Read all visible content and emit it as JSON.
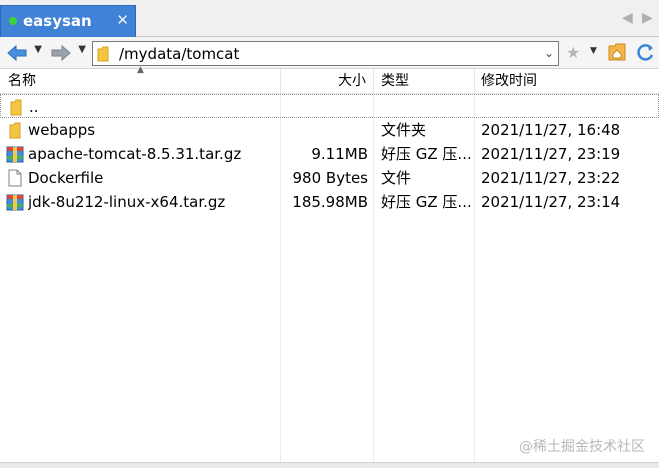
{
  "tab": {
    "label": "easysan",
    "close": "✕"
  },
  "address": {
    "path": "/mydata/tomcat"
  },
  "columns": {
    "name": "名称",
    "size": "大小",
    "type": "类型",
    "modified": "修改时间"
  },
  "files": [
    {
      "name": "..",
      "size": "",
      "type": "",
      "modified": "",
      "icon": "folder-icon"
    },
    {
      "name": "webapps",
      "size": "",
      "type": "文件夹",
      "modified": "2021/11/27, 16:48",
      "icon": "folder-icon"
    },
    {
      "name": "apache-tomcat-8.5.31.tar.gz",
      "size": "9.11MB",
      "type": "好压 GZ 压...",
      "modified": "2021/11/27, 23:19",
      "icon": "archive-icon"
    },
    {
      "name": "Dockerfile",
      "size": "980 Bytes",
      "type": "文件",
      "modified": "2021/11/27, 23:22",
      "icon": "file-icon"
    },
    {
      "name": "jdk-8u212-linux-x64.tar.gz",
      "size": "185.98MB",
      "type": "好压 GZ 压...",
      "modified": "2021/11/27, 23:14",
      "icon": "archive-icon"
    }
  ],
  "watermark": "@稀土掘金技术社区"
}
